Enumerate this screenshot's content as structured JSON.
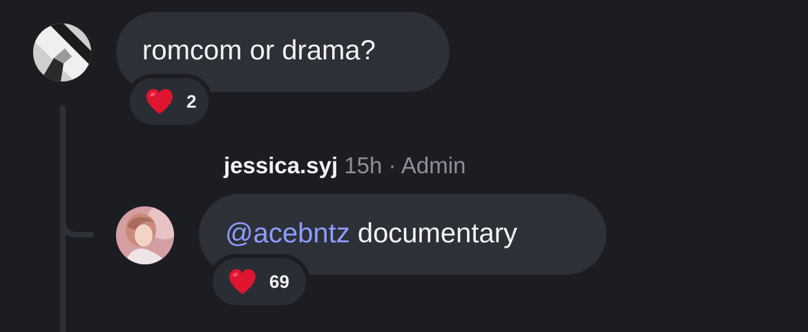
{
  "comments": [
    {
      "text": "romcom or drama?",
      "reaction": {
        "icon": "heart-icon",
        "count": "2"
      }
    },
    {
      "username": "jessica.syj",
      "time": "15h",
      "separator": "·",
      "role": "Admin",
      "mention": "@acebntz",
      "text": " documentary",
      "reaction": {
        "icon": "heart-icon",
        "count": "69"
      }
    }
  ],
  "colors": {
    "background": "#1c1d22",
    "bubble": "#2e3038",
    "mention": "#8b9dff",
    "meta": "#8d9099",
    "heart": "#e0152f"
  }
}
